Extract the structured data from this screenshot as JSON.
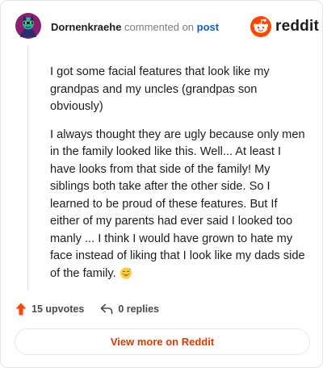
{
  "comment": {
    "username": "Dornenkraehe",
    "meta_text": "commented on",
    "post_link_label": "post",
    "paragraphs": [
      "I got some facial features that look like my grandpas and my uncles (grandpas son obviously)",
      "I always thought they are ugly because only men in the family looked like this. Well... At least I have looks from that side of the family! My siblings both take after the other side. So I learned to be proud of these features. But If either of my parents had ever said I looked too manly ... I think I would have grown to hate my face instead of liking that I look like my dads side of the family."
    ],
    "emoji_icon": "grinning-sweat-emoji"
  },
  "brand": {
    "name": "reddit",
    "accent_color": "#ff4500"
  },
  "actions": {
    "upvotes_label": "15 upvotes",
    "replies_label": "0 replies"
  },
  "footer": {
    "view_more_label": "View more on Reddit"
  },
  "colors": {
    "link": "#0b5fc6",
    "upvote": "#ff4500",
    "view_more_text": "#d93a00",
    "border": "#e3e6e8"
  },
  "icons": [
    "user-avatar",
    "reddit-snoo-icon",
    "upvote-arrow-icon",
    "reply-arrow-icon",
    "grinning-sweat-emoji"
  ]
}
